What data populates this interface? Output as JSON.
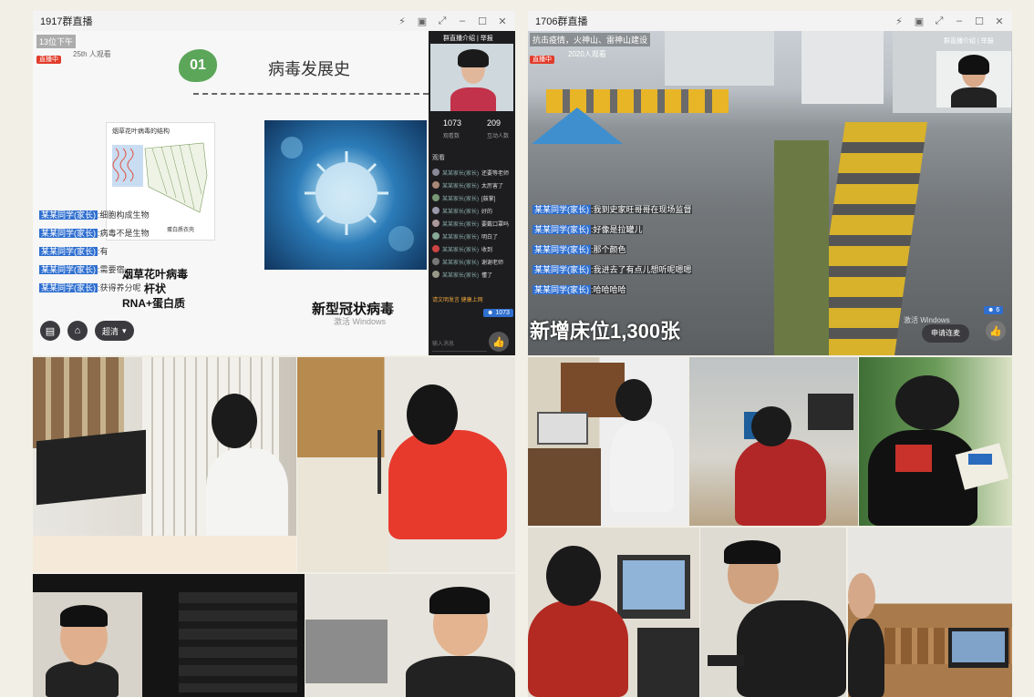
{
  "left_window": {
    "title": "1917群直播",
    "stream_title": "13位下午",
    "live_badge": "直播中",
    "viewers_small": "25th 人观看",
    "slide": {
      "number": "01",
      "heading": "病毒发展史",
      "diagram_caption": "烟草花叶病毒的结构",
      "diagram_label": "蛋白质衣壳",
      "virus_name": "烟草花叶病毒",
      "shape": "杆状",
      "composition": "RNA+蛋白质",
      "covid_caption": "新型冠状病毒"
    },
    "side_panel": {
      "header_links": "群直播介绍 | 举报",
      "stat1_value": "1073",
      "stat1_label": "观看数",
      "stat2_value": "209",
      "stat2_label": "互动人数",
      "section_label": "观看",
      "entries": [
        {
          "name": "某某家长(家长)",
          "msg": "还要等老师"
        },
        {
          "name": "某某家长(家长)",
          "msg": "太厉害了"
        },
        {
          "name": "某某家长(家长)",
          "msg": "[鼓掌]"
        },
        {
          "name": "某某家长(家长)",
          "msg": "好的"
        },
        {
          "name": "某某家长(家长)",
          "msg": "要戴口罩吗"
        },
        {
          "name": "某某家长(家长)",
          "msg": "明白了"
        },
        {
          "name": "某某家长(家长)",
          "msg": "收到"
        },
        {
          "name": "某某家长(家长)",
          "msg": "谢谢老师"
        },
        {
          "name": "某某家长(家长)",
          "msg": "懂了"
        }
      ],
      "footer_warning": "请文明发言 健康上网",
      "input_placeholder": "输入消息",
      "online_count": "1073"
    },
    "chat_overlay": [
      {
        "who": "某某同学(家长)",
        "msg": ":细胞构成生物"
      },
      {
        "who": "某某同学(家长)",
        "msg": ":病毒不是生物"
      },
      {
        "who": "某某同学(家长)",
        "msg": ":有"
      },
      {
        "who": "某某同学(家长)",
        "msg": ":需要宿"
      },
      {
        "who": "某某同学(家长)",
        "msg": ":获得养分呢"
      }
    ],
    "bottom_controls": {
      "quality_label": "超清"
    },
    "watermark": "激活 Windows"
  },
  "right_window": {
    "title": "1706群直播",
    "stream_title": "抗击疫情，火神山、雷神山建设",
    "live_badge": "直播中",
    "viewers_small": "2020人观看",
    "header_links": "群直播介绍 | 举报",
    "chat_overlay": [
      {
        "who": "某某同学(家长)",
        "msg": ":我到史家旺哥哥在现场监督"
      },
      {
        "who": "某某同学(家长)",
        "msg": ":好像是拉罐儿"
      },
      {
        "who": "某某同学(家长)",
        "msg": ":那个颜色"
      },
      {
        "who": "某某同学(家长)",
        "msg": ":我进去了有点儿想听呢嗯嗯"
      },
      {
        "who": "某某同学(家长)",
        "msg": ":哈哈哈哈"
      }
    ],
    "caption": "新增床位1,300张",
    "connect_button": "申请连麦",
    "online_count": "6",
    "watermark": "激活 Windows"
  }
}
